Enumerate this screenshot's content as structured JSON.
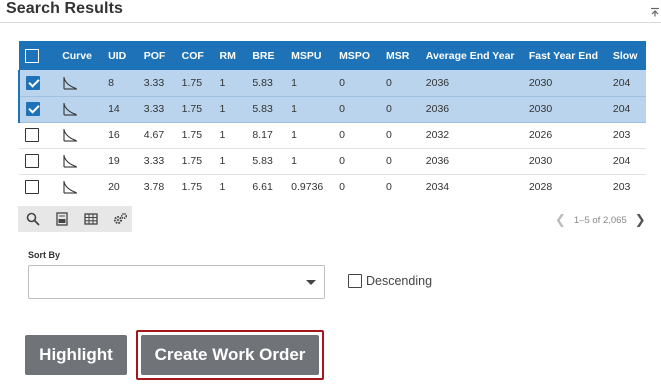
{
  "panel": {
    "title": "Search Results",
    "collapse_icon": "collapse-up-icon"
  },
  "grid": {
    "columns": [
      "Curve",
      "UID",
      "POF",
      "COF",
      "RM",
      "BRE",
      "MSPU",
      "MSPO",
      "MSR",
      "Average End Year",
      "Fast Year End",
      "Slow"
    ],
    "rows": [
      {
        "selected": true,
        "uid": "8",
        "pof": "3.33",
        "cof": "1.75",
        "rm": "1",
        "bre": "5.83",
        "mspu": "1",
        "mspo": "0",
        "msr": "0",
        "avg_end_year": "2036",
        "fast_year_end": "2030",
        "slow": "204"
      },
      {
        "selected": true,
        "uid": "14",
        "pof": "3.33",
        "cof": "1.75",
        "rm": "1",
        "bre": "5.83",
        "mspu": "1",
        "mspo": "0",
        "msr": "0",
        "avg_end_year": "2036",
        "fast_year_end": "2030",
        "slow": "204"
      },
      {
        "selected": false,
        "uid": "16",
        "pof": "4.67",
        "cof": "1.75",
        "rm": "1",
        "bre": "8.17",
        "mspu": "1",
        "mspo": "0",
        "msr": "0",
        "avg_end_year": "2032",
        "fast_year_end": "2026",
        "slow": "203"
      },
      {
        "selected": false,
        "uid": "19",
        "pof": "3.33",
        "cof": "1.75",
        "rm": "1",
        "bre": "5.83",
        "mspu": "1",
        "mspo": "0",
        "msr": "0",
        "avg_end_year": "2036",
        "fast_year_end": "2030",
        "slow": "204"
      },
      {
        "selected": false,
        "uid": "20",
        "pof": "3.78",
        "cof": "1.75",
        "rm": "1",
        "bre": "6.61",
        "mspu": "0.9736",
        "mspo": "0",
        "msr": "0",
        "avg_end_year": "2034",
        "fast_year_end": "2028",
        "slow": "203"
      }
    ],
    "row_icon": "decay-curve-icon",
    "selection_color": "#b9d4ec",
    "header_color": "#1e73b8"
  },
  "toolbar": {
    "icons": [
      "search-icon",
      "export-icon",
      "table-icon",
      "settings-gears-icon"
    ]
  },
  "pager": {
    "range_text": "1–5 of 2,065"
  },
  "sort": {
    "label": "Sort By",
    "value": "",
    "descending_label": "Descending",
    "descending_checked": false
  },
  "actions": {
    "highlight_label": "Highlight",
    "create_work_order_label": "Create Work Order",
    "button_color": "#707378",
    "focus_color": "#a3161c"
  }
}
